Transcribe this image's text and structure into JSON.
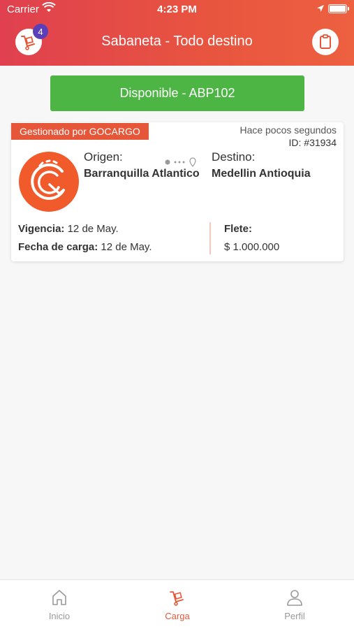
{
  "status_bar": {
    "carrier": "Carrier",
    "time": "4:23 PM"
  },
  "header": {
    "title": "Sabaneta - Todo destino",
    "badge_count": "4",
    "left_icon": "cargo-cart-icon",
    "right_icon": "clipboard-icon"
  },
  "status_button": {
    "label": "Disponible - ABP102"
  },
  "card": {
    "managed_by": "Gestionado por GOCARGO",
    "time_ago": "Hace pocos segundos",
    "id": "ID: #31934",
    "origin_label": "Origen:",
    "origin_value": "Barranquilla Atlantico",
    "destination_label": "Destino:",
    "destination_value": "Medellin Antioquia",
    "validity_label": "Vigencia:",
    "validity_value": "12 de May.",
    "load_date_label": "Fecha de carga:",
    "load_date_value": "12 de May.",
    "freight_label": "Flete:",
    "freight_value": "$ 1.000.000"
  },
  "tabs": [
    {
      "label": "Inicio",
      "icon": "home-icon"
    },
    {
      "label": "Carga",
      "icon": "cargo-cart-icon"
    },
    {
      "label": "Perfil",
      "icon": "user-icon"
    }
  ],
  "colors": {
    "header_gradient_start": "#e0404f",
    "header_gradient_end": "#ed6040",
    "accent": "#e6573a",
    "success": "#4cb543",
    "badge": "#5b3fb8"
  }
}
